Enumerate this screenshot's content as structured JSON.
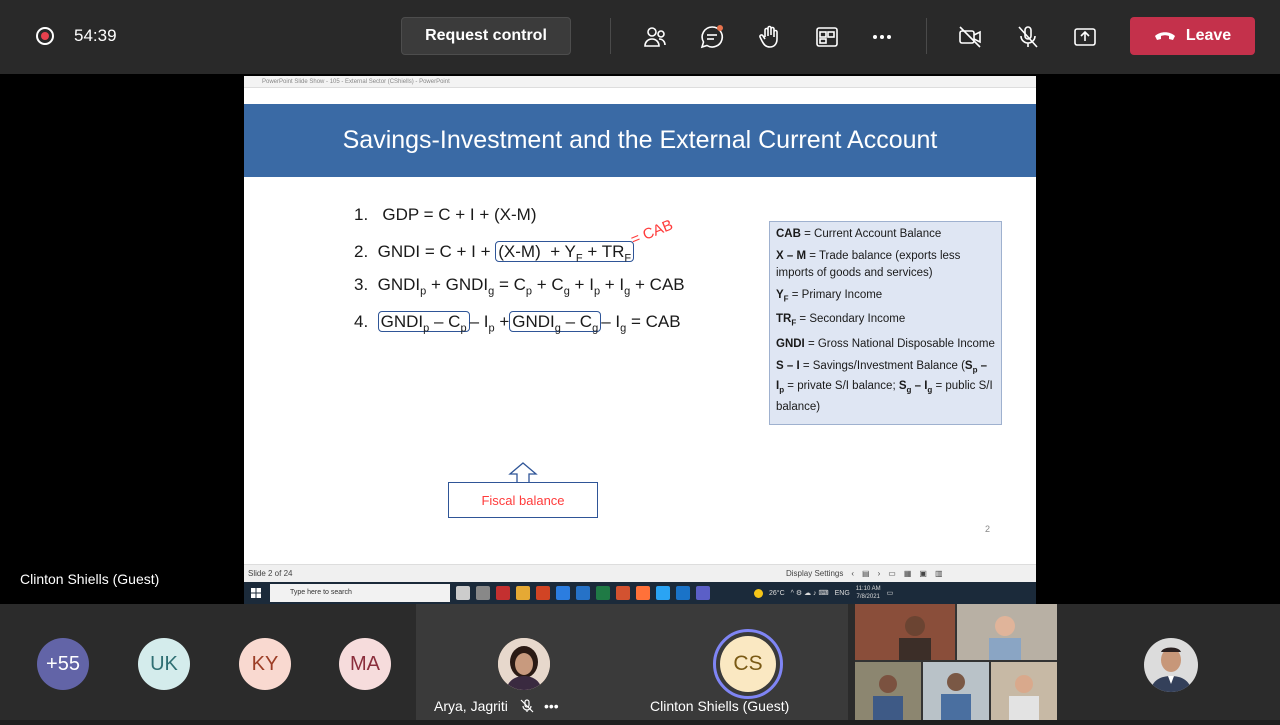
{
  "meeting": {
    "timer": "54:39",
    "request_control_label": "Request control",
    "leave_label": "Leave"
  },
  "colors": {
    "leave": "#c4314b",
    "slide_header": "#3a6aa5",
    "annotation": "#ff3b3b",
    "accent_purple": "#6264a7"
  },
  "toolbar_icons": [
    "participants-icon",
    "chat-icon",
    "raise-hand-icon",
    "share-tray-icon",
    "more-icon",
    "camera-off-icon",
    "mic-off-icon",
    "share-icon"
  ],
  "ppt": {
    "titlebar": "PowerPoint Slide Show - 105 - External Sector (CShiells) - PowerPoint",
    "status_left": "Slide 2 of 24",
    "display_settings": "Display Settings",
    "taskbar_search": "Type here to search",
    "weather": "26°C",
    "lang": "ENG",
    "time": "11:10 AM",
    "date": "7/8/2021"
  },
  "slide": {
    "title": "Savings-Investment and the External Current Account",
    "annotation": "= CAB",
    "fiscal_label": "Fiscal balance",
    "page_number": "2",
    "equations": {
      "n1": "1.",
      "n2": "2.",
      "n3": "3.",
      "n4": "4.",
      "eq1": "GDP   = C + I + (X-M)"
    },
    "legend": {
      "cab_term": "CAB",
      "cab_def": " = Current Account Balance",
      "xm_term": "X – M",
      "xm_def": " = Trade balance (exports less imports of goods and services)",
      "yf_def": " = Primary Income",
      "trf_def": " = Secondary Income",
      "gndi_term": "GNDI",
      "gndi_def": " = Gross National Disposable Income",
      "si_term": "S – I",
      "si_def1": " = Savings/Investment Balance (",
      "si_def2": " = private S/I balance; ",
      "si_def3": " = public S/I balance)"
    }
  },
  "presenter_name": "Clinton Shiells (Guest)",
  "participants": [
    {
      "initials": "+55",
      "bg": "#6264a7",
      "fg": "#ffffff"
    },
    {
      "initials": "UK",
      "bg": "#d4ecec",
      "fg": "#2f6f73"
    },
    {
      "initials": "KY",
      "bg": "#f9d9d0",
      "fg": "#9c3d26"
    },
    {
      "initials": "MA",
      "bg": "#f6dcdc",
      "fg": "#8b2e3c"
    }
  ],
  "tiles": {
    "arya": "Arya, Jagriti",
    "clinton_initials": "CS",
    "clinton": "Clinton Shiells (Guest)"
  }
}
